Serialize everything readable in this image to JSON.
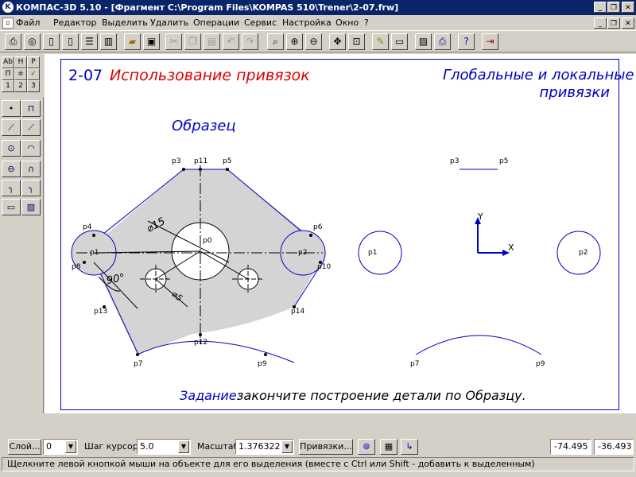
{
  "window": {
    "title": "КОМПАС-3D 5.10 - [Фрагмент C:\\Program Files\\KOMPAS 510\\Trener\\2-07.frw]",
    "app_icon": "kompas-logo-icon"
  },
  "menu": {
    "items": [
      "Файл",
      "Редактор",
      "Выделить",
      "Удалить",
      "Операции",
      "Сервис",
      "Настройка",
      "Окно",
      "?"
    ]
  },
  "toolbar": {
    "icons": [
      "new-document-icon",
      "new-fragment-icon",
      "new-sheet-icon",
      "new-spec-icon",
      "new-text-icon",
      "new-assembly-icon",
      "open-icon",
      "save-icon",
      "cut-icon",
      "copy-icon",
      "paste-icon",
      "undo-icon",
      "redo-icon",
      "zoom-icon",
      "zoom-in-icon",
      "zoom-out-icon",
      "pan-icon",
      "show-all-icon",
      "redraw-icon",
      "layers-icon",
      "print-preview-icon",
      "print-icon",
      "help-pointer-icon",
      "exit-icon"
    ]
  },
  "left_top": {
    "row1": [
      "Ab",
      "H",
      "P"
    ],
    "row2": [
      "П",
      "≑",
      "✓"
    ],
    "row3": [
      "1",
      "2",
      "3"
    ]
  },
  "drawing": {
    "code": "2-07",
    "title": "Использование привязок",
    "heading_line1": "Глобальные и локальные",
    "heading_line2": "привязки",
    "sample_label": "Образец",
    "task_label": "Задание:",
    "task_text": "закончите построение детали по Образцу.",
    "dims": {
      "d15": "⌀15",
      "d5": "⌀5",
      "angle": "90°"
    },
    "points_left": {
      "p0": "p0",
      "p1": "p1",
      "p2": "p2",
      "p3": "p3",
      "p4": "p4",
      "p5": "p5",
      "p6": "p6",
      "p7": "p7",
      "p8": "p8",
      "p9": "p9",
      "p10": "p10",
      "p11": "p11",
      "p12": "p12",
      "p13": "p13",
      "p14": "p14"
    },
    "points_right": {
      "p1": "p1",
      "p2": "p2",
      "p3": "p3",
      "p5": "p5",
      "p7": "p7",
      "p9": "p9"
    },
    "axis": {
      "x": "X",
      "y": "Y"
    },
    "colors": {
      "outline": "#0000c0",
      "fill": "#d4d4d4",
      "title_red": "#e00000",
      "frame": "#0000c0"
    }
  },
  "status": {
    "layer_button": "Слой...",
    "layer_value": "0",
    "step_label": "Шаг курсора",
    "step_value": "5.0",
    "scale_label": "Масштаб",
    "scale_value": "1.376322",
    "snaps_button": "Привязки...",
    "coord_x": "-74.495",
    "coord_y": "-36.493",
    "hint": "Щелкните левой кнопкой мыши на объекте для его выделения (вместе с Ctrl или Shift - добавить к выделенным)"
  }
}
